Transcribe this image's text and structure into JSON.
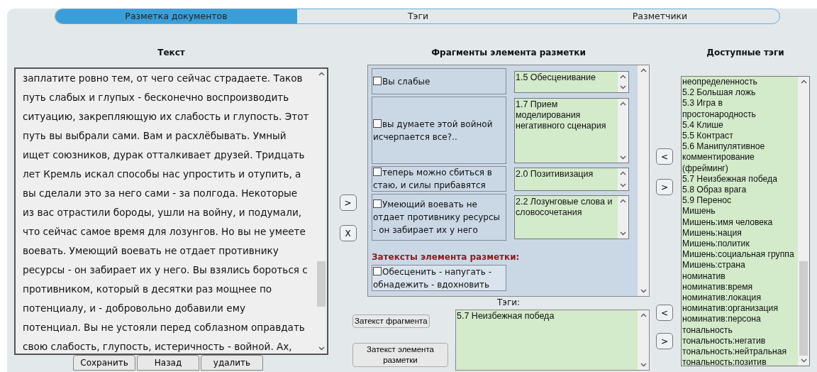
{
  "tabs": [
    {
      "label": "Разметка документов",
      "selected": true
    },
    {
      "label": "Тэги",
      "selected": false
    },
    {
      "label": "Разметчики",
      "selected": false
    }
  ],
  "text_panel": {
    "heading": "Текст",
    "lines": [
      "заплатите ровно тем, от чего сейчас страдаете. Таков",
      "путь слабых и глупых - бесконечно воспроизводить",
      "ситуацию, закрепляющую их слабость и глупость. Этот",
      "путь вы выбрали сами. Вам и расхлёбывать. Умный",
      "ищет союзников, дурак отталкивает друзей. Тридцать",
      "лет Кремль искал способы нас упростить и отупить, а",
      "вы сделали это за него сами - за полгода. Некоторые",
      "из вас отрастили бороды, ушли на войну, и подумали,",
      "что сейчас самое время для лозунгов. Но вы не умеете",
      "воевать. Умеющий воевать не отдает противнику",
      "ресурсы - он забирает их у него. Вы взялись бороться с",
      "противником, который в десятки раз мощнее по",
      "потенциалу, и - добровольно добавили ему",
      "потенциал. Вы не устояли перед соблазном оправдать",
      "свою слабость, глупость, истеричность - войной. Ах,"
    ],
    "buttons": [
      "Сохранить",
      "Назад",
      "удалить"
    ]
  },
  "transfer_buttons": [
    ">",
    "X"
  ],
  "fragments_panel": {
    "heading": "Фрагменты элемента разметки",
    "fragments": [
      {
        "text": "Вы слабые",
        "checked": false,
        "tags": "1.5 Обесценивание"
      },
      {
        "text": "вы думаете этой войной исчерпается все?..",
        "checked": false,
        "tags": "1.7 Прием моделирования негативного сценария"
      },
      {
        "text": "теперь можно сбиться в стаю, и силы прибавятся",
        "checked": false,
        "tags": "2.0 Позитивизация"
      },
      {
        "text": "Умеющий воевать не отдает противнику ресурсы - он забирает их у него",
        "checked": false,
        "tags": "2.2 Лозунговые слова и словосочетания"
      }
    ],
    "subtexts_heading": "Затексты элемента разметки:",
    "subtexts": [
      {
        "text": "Обесценить - напугать - обнадежить - вдохновить",
        "checked": false
      }
    ]
  },
  "tags_label": "Тэги:",
  "subtext_buttons": [
    "Затекст фрагмента",
    "Затекст элемента разметки"
  ],
  "element_tags": "5.7 Неизбежная победа",
  "tag_move_buttons_top": [
    "<",
    ">"
  ],
  "tag_move_buttons_bottom": [
    "<",
    ">"
  ],
  "available_tags": {
    "heading": "Доступные тэги",
    "items": [
      "неопределенность",
      "5.2 Большая ложь",
      "5.3 Игра в простонародность",
      "5.4 Клише",
      "5.5 Контраст",
      "5.6 Манипулятивное комментирование (фрейминг)",
      "5.7 Неизбежная победа",
      "5.8 Образ врага",
      "5.9 Перенос",
      "Мишень",
      "Мишень:имя человека",
      "Мишень:нация",
      "Мишень:политик",
      "Мишень:социальная группа",
      "Мишень:страна",
      "номинатив",
      "номинатив:время",
      "номинатив:локация",
      "номинатив:организация",
      "номинатив:персона",
      "тональность",
      "тональность:негатив",
      "тональность:нейтральная",
      "тональность:позитив"
    ]
  }
}
